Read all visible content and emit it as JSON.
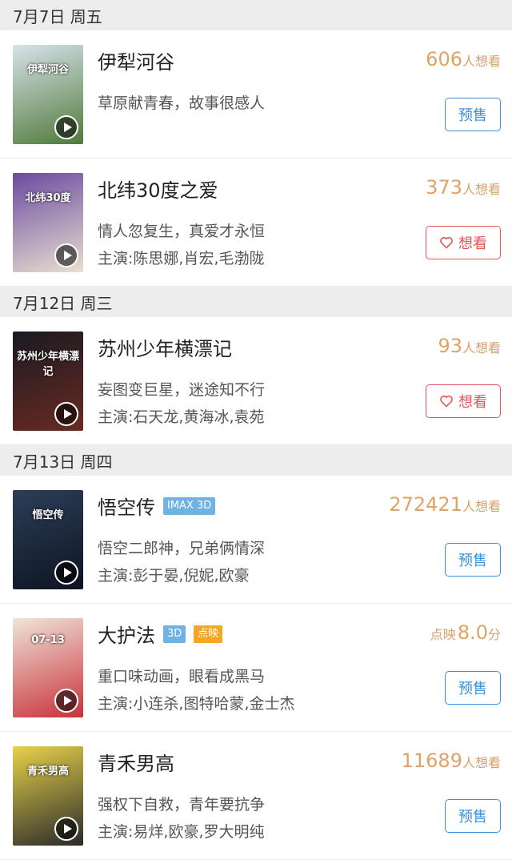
{
  "sections": [
    {
      "date": "7月7日 周五",
      "movies": [
        {
          "title": "伊犁河谷",
          "tags": [],
          "count": "606",
          "count_suffix": "人想看",
          "count_prefix": "",
          "desc": "草原献青春，故事很感人",
          "cast": "",
          "button": "预售",
          "button_type": "presale",
          "poster_colors": [
            "#d8e2ea",
            "#4f7a3a"
          ],
          "poster_text": "伊犁河谷"
        },
        {
          "title": "北纬30度之爱",
          "tags": [],
          "count": "373",
          "count_suffix": "人想看",
          "count_prefix": "",
          "desc": "情人忽复生，真爱才永恒",
          "cast": "主演:陈思娜,肖宏,毛渤陇",
          "button": "想看",
          "button_type": "want",
          "poster_colors": [
            "#6a4aa0",
            "#e8dfd0"
          ],
          "poster_text": "北纬30度"
        }
      ]
    },
    {
      "date": "7月12日 周三",
      "movies": [
        {
          "title": "苏州少年横漂记",
          "tags": [],
          "count": "93",
          "count_suffix": "人想看",
          "count_prefix": "",
          "desc": "妄图变巨星，迷途知不行",
          "cast": "主演:石天龙,黄海冰,袁苑",
          "button": "想看",
          "button_type": "want",
          "poster_colors": [
            "#1a1a22",
            "#6a2a22"
          ],
          "poster_text": "苏州少年横漂记"
        }
      ]
    },
    {
      "date": "7月13日 周四",
      "movies": [
        {
          "title": "悟空传",
          "tags": [
            {
              "label": "IMAX 3D",
              "color": "blue"
            }
          ],
          "count": "272421",
          "count_suffix": "人想看",
          "count_prefix": "",
          "desc": "悟空二郎神，兄弟俩情深",
          "cast": "主演:彭于晏,倪妮,欧豪",
          "button": "预售",
          "button_type": "presale",
          "poster_colors": [
            "#2c3e58",
            "#0e1420"
          ],
          "poster_text": "悟空传"
        },
        {
          "title": "大护法",
          "tags": [
            {
              "label": "3D",
              "color": "blue"
            },
            {
              "label": "点映",
              "color": "orange"
            }
          ],
          "count": "8.0",
          "count_suffix": "分",
          "count_prefix": "点映",
          "desc": "重口味动画，眼看成黑马",
          "cast": "主演:小连杀,图特哈蒙,金士杰",
          "button": "预售",
          "button_type": "presale",
          "poster_colors": [
            "#f0e4d8",
            "#c8323a"
          ],
          "poster_text": "07-13"
        },
        {
          "title": "青禾男高",
          "tags": [],
          "count": "11689",
          "count_suffix": "人想看",
          "count_prefix": "",
          "desc": "强权下自救，青年要抗争",
          "cast": "主演:易烊,欧豪,罗大明纯",
          "button": "预售",
          "button_type": "presale",
          "poster_colors": [
            "#e8d24a",
            "#2a2a2a"
          ],
          "poster_text": "青禾男高"
        }
      ]
    }
  ]
}
